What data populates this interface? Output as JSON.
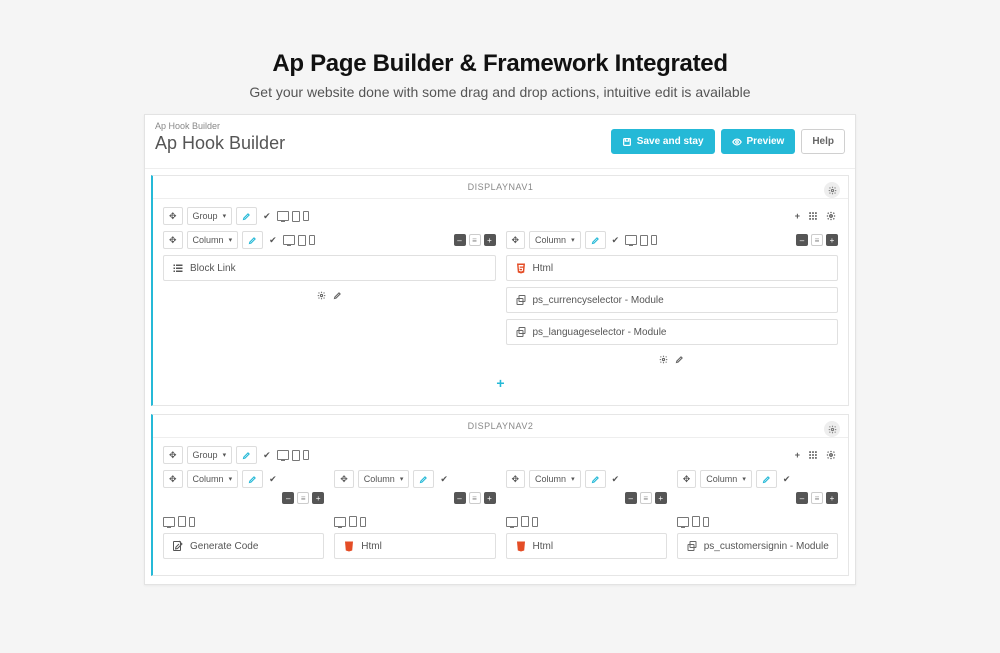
{
  "page": {
    "heading": "Ap Page Builder & Framework Integrated",
    "sub": "Get your website done with some drag and drop actions, intuitive edit is available"
  },
  "header": {
    "breadcrumb": "Ap Hook Builder",
    "title": "Ap Hook Builder",
    "btn_save": "Save and stay",
    "btn_preview": "Preview",
    "btn_help": "Help"
  },
  "labels": {
    "group": "Group",
    "column": "Column"
  },
  "sections": [
    {
      "title": "DISPLAYNAV1",
      "columns": [
        {
          "widgets": [
            "Block Link"
          ],
          "showAddCenter": true
        },
        {
          "widgets": [
            "Html",
            "ps_currencyselector - Module",
            "ps_languageselector - Module"
          ],
          "showAddCenter": true
        }
      ]
    },
    {
      "title": "DISPLAYNAV2",
      "columns": [
        {
          "widgets": [
            "Generate Code"
          ]
        },
        {
          "widgets": [
            "Html"
          ]
        },
        {
          "widgets": [
            "Html"
          ]
        },
        {
          "widgets": [
            "ps_customersignin - Module"
          ]
        }
      ],
      "wrapDevices": true
    }
  ],
  "icons": {
    "block_link": "list",
    "html": "shield",
    "module": "copy",
    "generate": "edit"
  }
}
